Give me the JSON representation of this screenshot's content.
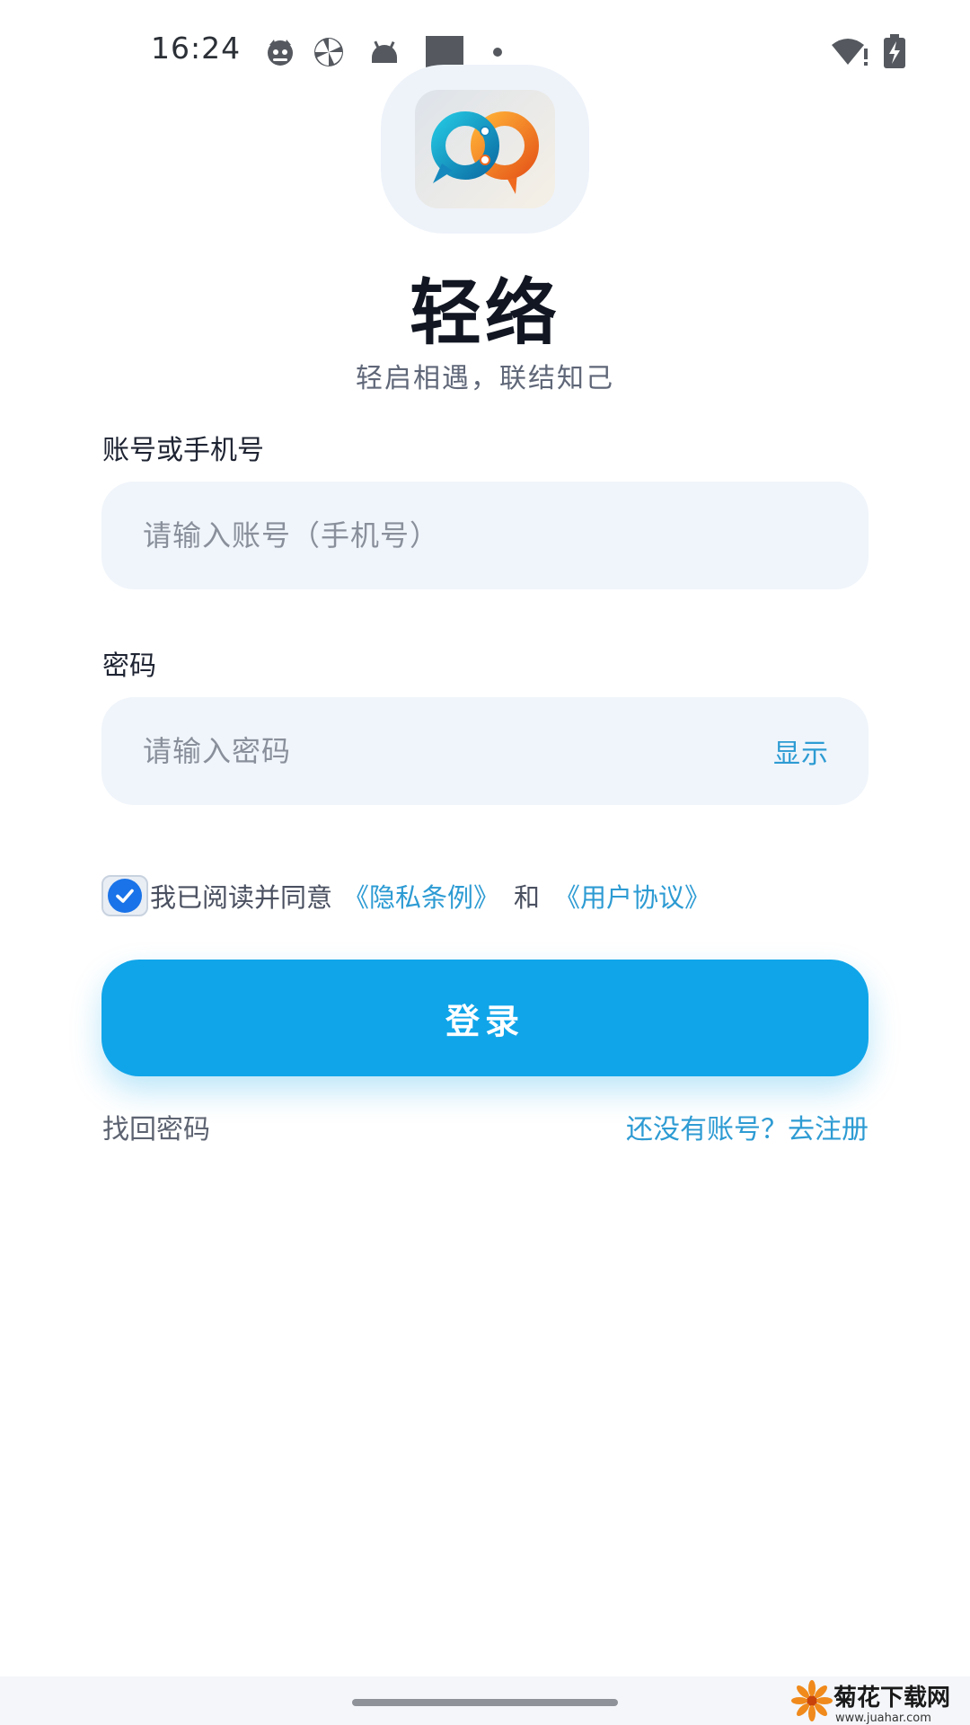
{
  "status_bar": {
    "time": "16:24",
    "icons": [
      "cat-face-icon",
      "pinwheel-icon",
      "android-icon",
      "square-icon",
      "dot-icon",
      "wifi-alert-icon",
      "battery-charging-icon"
    ]
  },
  "app": {
    "logo_icon": "chat-link-logo-icon",
    "name": "轻络",
    "slogan": "轻启相遇，联结知己"
  },
  "form": {
    "account_label": "账号或手机号",
    "account_placeholder": "请输入账号（手机号）",
    "account_value": "",
    "password_label": "密码",
    "password_placeholder": "请输入密码",
    "password_value": "",
    "show_password_label": "显示"
  },
  "agreement": {
    "checked": true,
    "prefix": "我已阅读并同意",
    "privacy_link": "《隐私条例》",
    "and": "和",
    "terms_link": "《用户协议》"
  },
  "actions": {
    "login_label": "登录",
    "forgot_password": "找回密码",
    "register_prompt": "还没有账号？去注册"
  },
  "watermark": {
    "site_name": "菊花下载网",
    "site_url": "www.juahar.com"
  },
  "colors": {
    "accent": "#10a5e9",
    "link": "#2d9bd3",
    "input_bg": "#f0f5fb",
    "checkbox": "#1a73e8"
  }
}
